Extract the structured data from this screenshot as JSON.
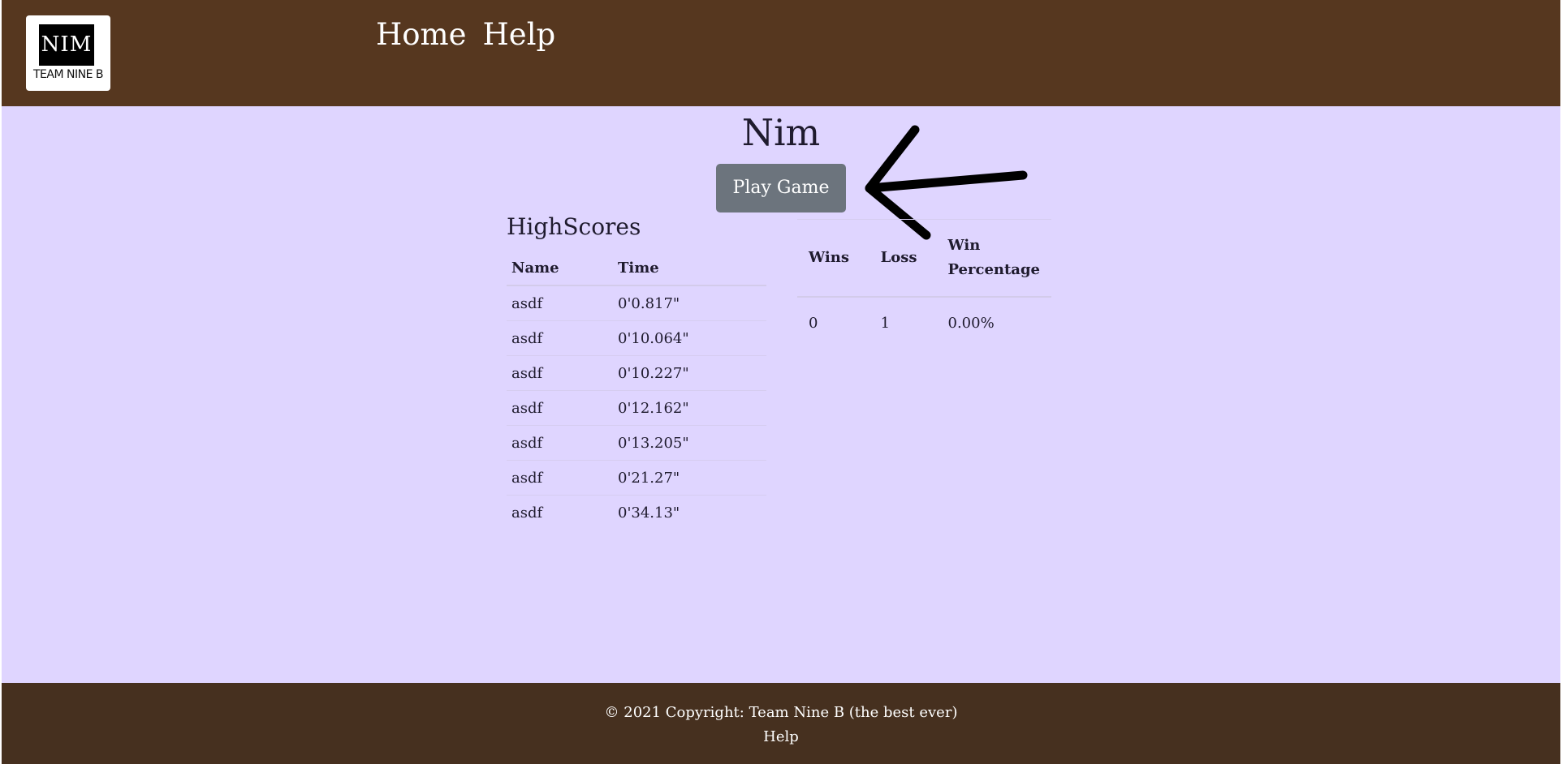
{
  "header": {
    "logo": {
      "mark": "NIM",
      "subtitle": "TEAM NINE B"
    },
    "nav": [
      {
        "label": "Home"
      },
      {
        "label": "Help"
      }
    ],
    "background_color": "#56371f"
  },
  "main": {
    "title": "Nim",
    "play_button_label": "Play Game",
    "background_color": "#dfd5ff",
    "annotation": "arrow pointing at play button"
  },
  "highscores": {
    "title": "HighScores",
    "columns": [
      "Name",
      "Time"
    ],
    "rows": [
      {
        "name": "asdf",
        "time": "0'0.817\""
      },
      {
        "name": "asdf",
        "time": "0'10.064\""
      },
      {
        "name": "asdf",
        "time": "0'10.227\""
      },
      {
        "name": "asdf",
        "time": "0'12.162\""
      },
      {
        "name": "asdf",
        "time": "0'13.205\""
      },
      {
        "name": "asdf",
        "time": "0'21.27\""
      },
      {
        "name": "asdf",
        "time": "0'34.13\""
      }
    ]
  },
  "stats": {
    "columns": [
      "Wins",
      "Loss",
      "Win Percentage"
    ],
    "row": {
      "wins": "0",
      "loss": "1",
      "win_percentage": "0.00%"
    }
  },
  "footer": {
    "copyright": "© 2021 Copyright: Team Nine B (the best ever)",
    "help_label": "Help",
    "background_color": "#46301f"
  }
}
